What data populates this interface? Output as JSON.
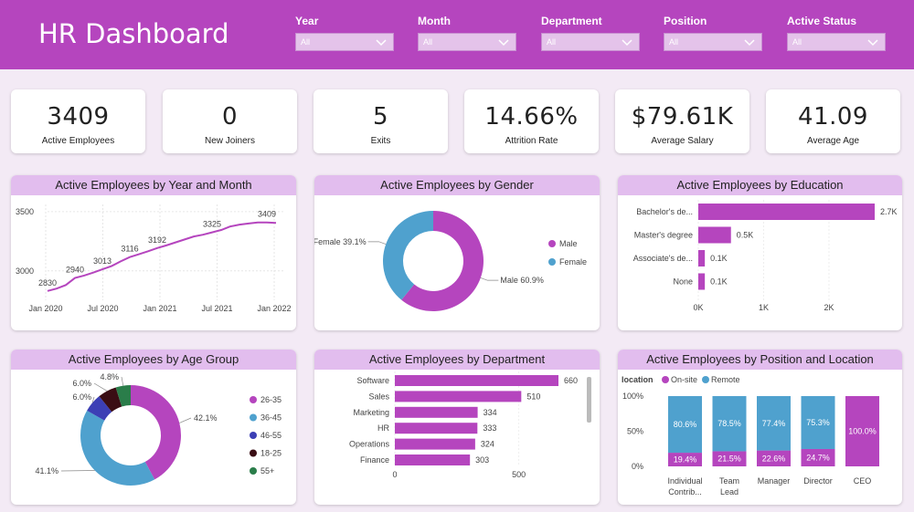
{
  "header": {
    "title": "HR Dashboard",
    "filters": [
      {
        "label": "Year",
        "value": "All"
      },
      {
        "label": "Month",
        "value": "All"
      },
      {
        "label": "Department",
        "value": "All"
      },
      {
        "label": "Position",
        "value": "All"
      },
      {
        "label": "Active Status",
        "value": "All"
      }
    ]
  },
  "kpis": [
    {
      "value": "3409",
      "label": "Active Employees"
    },
    {
      "value": "0",
      "label": "New Joiners"
    },
    {
      "value": "5",
      "label": "Exits"
    },
    {
      "value": "14.66%",
      "label": "Attrition Rate"
    },
    {
      "value": "$79.61K",
      "label": "Average Salary"
    },
    {
      "value": "41.09",
      "label": "Average Age"
    }
  ],
  "colors": {
    "purple": "#b545be",
    "blue": "#4fa1ce",
    "navy": "#3c3fb5",
    "dark": "#3a0d14",
    "green": "#2a7d4a",
    "title_bg": "#e2bdee"
  },
  "chart_data": [
    {
      "type": "line",
      "title": "Active Employees by Year and Month",
      "x_ticks": [
        "Jan 2020",
        "Jul 2020",
        "Jan 2021",
        "Jul 2021",
        "Jan 2022"
      ],
      "y_ticks": [
        "3000",
        "3500"
      ],
      "ylim": [
        2790,
        3530
      ],
      "labels": [
        {
          "i": 0,
          "text": "2830"
        },
        {
          "i": 3,
          "text": "2940"
        },
        {
          "i": 6,
          "text": "3013"
        },
        {
          "i": 9,
          "text": "3116"
        },
        {
          "i": 12,
          "text": "3192"
        },
        {
          "i": 18,
          "text": "3325"
        },
        {
          "i": 24,
          "text": "3409"
        }
      ],
      "values": [
        2830,
        2850,
        2880,
        2940,
        2960,
        2985,
        3013,
        3040,
        3080,
        3116,
        3140,
        3165,
        3192,
        3215,
        3240,
        3265,
        3290,
        3305,
        3325,
        3345,
        3375,
        3390,
        3400,
        3409,
        3409,
        3405
      ]
    },
    {
      "type": "pie",
      "title": "Active Employees by Gender",
      "slices": [
        {
          "name": "Male",
          "value": 60.9,
          "label": "Male 60.9%",
          "color": "#b545be"
        },
        {
          "name": "Female",
          "value": 39.1,
          "label": "Female 39.1%",
          "color": "#4fa1ce"
        }
      ],
      "legend": [
        "Male",
        "Female"
      ]
    },
    {
      "type": "bar",
      "title": "Active Employees by Education",
      "categories": [
        "Bachelor's de...",
        "Master's degree",
        "Associate's de...",
        "None"
      ],
      "values": [
        2700,
        500,
        100,
        100
      ],
      "data_labels": [
        "2.7K",
        "0.5K",
        "0.1K",
        "0.1K"
      ],
      "x_ticks": [
        "0K",
        "1K",
        "2K"
      ],
      "xlim": [
        0,
        2700
      ]
    },
    {
      "type": "pie",
      "title": "Active Employees by Age Group",
      "slices": [
        {
          "name": "26-35",
          "value": 42.1,
          "label": "42.1%",
          "color": "#b545be"
        },
        {
          "name": "36-45",
          "value": 41.1,
          "label": "41.1%",
          "color": "#4fa1ce"
        },
        {
          "name": "46-55",
          "value": 6.0,
          "label": "6.0%",
          "color": "#3c3fb5"
        },
        {
          "name": "18-25",
          "value": 6.0,
          "label": "6.0%",
          "color": "#3a0d14"
        },
        {
          "name": "55+",
          "value": 4.8,
          "label": "4.8%",
          "color": "#2a7d4a"
        }
      ],
      "legend": [
        "26-35",
        "36-45",
        "46-55",
        "18-25",
        "55+"
      ]
    },
    {
      "type": "bar",
      "title": "Active Employees by Department",
      "categories": [
        "Software",
        "Sales",
        "Marketing",
        "HR",
        "Operations",
        "Finance"
      ],
      "values": [
        660,
        510,
        334,
        333,
        324,
        303
      ],
      "data_labels": [
        "660",
        "510",
        "334",
        "333",
        "324",
        "303"
      ],
      "x_ticks": [
        "0",
        "500"
      ],
      "xlim": [
        0,
        660
      ]
    },
    {
      "type": "bar",
      "title": "Active Employees by Position and Location",
      "legend_title": "location",
      "legend": [
        "On-site",
        "Remote"
      ],
      "categories": [
        "Individual Contrib...",
        "Team Lead",
        "Manager",
        "Director",
        "CEO"
      ],
      "category_lines": [
        [
          "Individual",
          "Contrib..."
        ],
        [
          "Team",
          "Lead"
        ],
        [
          "Manager"
        ],
        [
          "Director"
        ],
        [
          "CEO"
        ]
      ],
      "series": [
        {
          "name": "On-site",
          "values": [
            19.4,
            21.5,
            22.6,
            24.7,
            100.0
          ],
          "labels": [
            "19.4%",
            "21.5%",
            "22.6%",
            "24.7%",
            "100.0%"
          ],
          "color": "#b545be"
        },
        {
          "name": "Remote",
          "values": [
            80.6,
            78.5,
            77.4,
            75.3,
            0
          ],
          "labels": [
            "80.6%",
            "78.5%",
            "77.4%",
            "75.3%",
            ""
          ],
          "color": "#4fa1ce"
        }
      ],
      "y_ticks": [
        "100%",
        "50%",
        "0%"
      ]
    }
  ]
}
